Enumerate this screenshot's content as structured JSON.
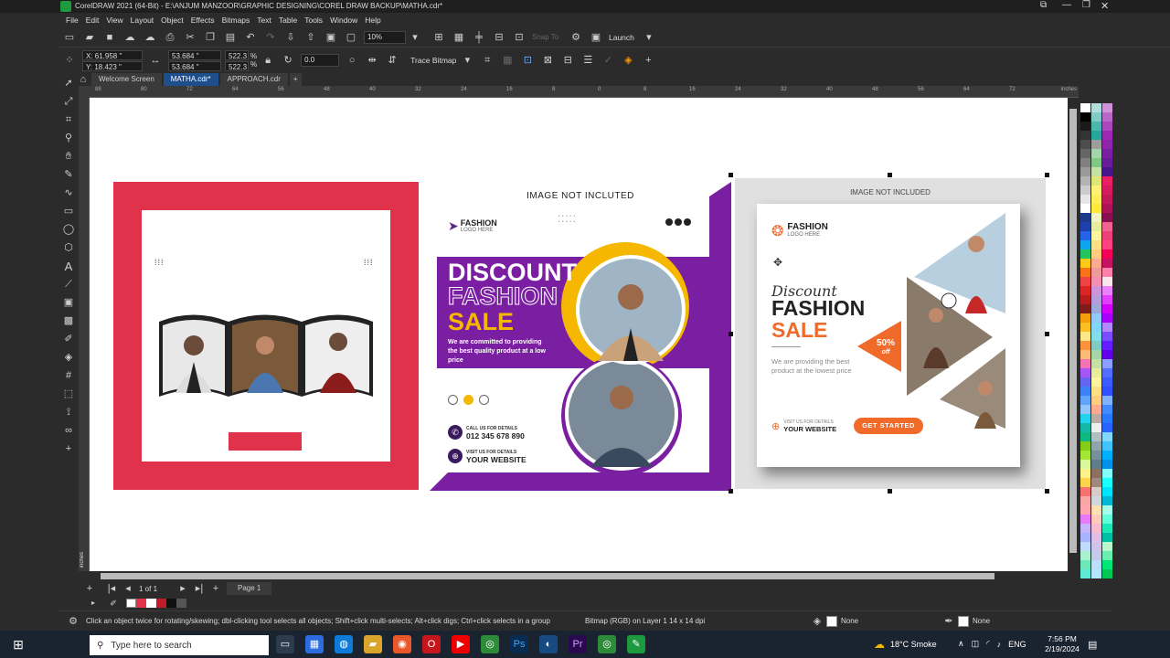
{
  "app": {
    "title": "CorelDRAW 2021 (64-Bit) - E:\\ANJUM MANZOOR\\GRAPHIC DESIGNING\\COREL DRAW BACKUP\\MATHA.cdr*"
  },
  "menu": [
    "File",
    "Edit",
    "View",
    "Layout",
    "Object",
    "Effects",
    "Bitmaps",
    "Text",
    "Table",
    "Tools",
    "Window",
    "Help"
  ],
  "toolbar": {
    "zoom": "10%",
    "snap_to": "Snap To",
    "launch": "Launch"
  },
  "props": {
    "x": "X: 61.958 \"",
    "y": "Y: 18.423 \"",
    "w": "53.684 \"",
    "h": "53.684 \"",
    "sx": "522.3",
    "sy": "522.3",
    "pct": "%",
    "angle": "0.0",
    "trace": "Trace Bitmap"
  },
  "tabs": [
    "Welcome Screen",
    "MATHA.cdr*",
    "APPROACH.cdr"
  ],
  "ruler": {
    "units": "inches",
    "marks": [
      "88",
      "80",
      "72",
      "64",
      "56",
      "48",
      "40",
      "32",
      "24",
      "16",
      "8",
      "0",
      "8",
      "16",
      "24",
      "32",
      "40",
      "48",
      "56",
      "64",
      "72",
      "80",
      "88"
    ]
  },
  "design2": {
    "note": "IMAGE NOT INCLUTED",
    "brand": "FASHION",
    "brand_sub": "LOGO HERE",
    "l1": "DISCOUNT",
    "l2": "FASHION",
    "l3": "SALE",
    "desc": "We are committed to providing the best quality product at a low price",
    "call_label": "CALL US FOR DETAILS",
    "phone": "012 345 678 890",
    "visit_label": "VISIT US FOR DETAILS",
    "website": "YOUR WEBSITE"
  },
  "design3": {
    "note": "IMAGE NOT INCLUDED",
    "brand": "FASHION",
    "brand_sub": "LOGO HERE",
    "script": "Discount",
    "l2": "FASHION",
    "l3": "SALE",
    "badge_num": "50%",
    "badge_off": "off",
    "desc": "We are providing the best product at the lowest price",
    "visit_label": "VISIT US FOR DETAILS",
    "website": "YOUR WEBSITE",
    "cta": "GET STARTED"
  },
  "pagebar": {
    "count": "1 of 1",
    "page": "Page 1"
  },
  "status": {
    "hint": "Click an object twice for rotating/skewing; dbl-clicking tool selects all objects; Shift+click multi-selects; Alt+click digs; Ctrl+click selects in a group",
    "info": "Bitmap (RGB) on Layer 1 14 x 14 dpi",
    "fill": "None",
    "outline": "None"
  },
  "taskbar": {
    "search": "Type here to search",
    "weather": "18°C Smoke",
    "lang": "ENG",
    "time": "7:56 PM",
    "date": "2/19/2024"
  },
  "colors": {
    "accent": "#1e4f8c",
    "purple": "#7b1fa2",
    "red": "#e0334b",
    "orange": "#f06a2a",
    "yellow": "#f5b700"
  }
}
